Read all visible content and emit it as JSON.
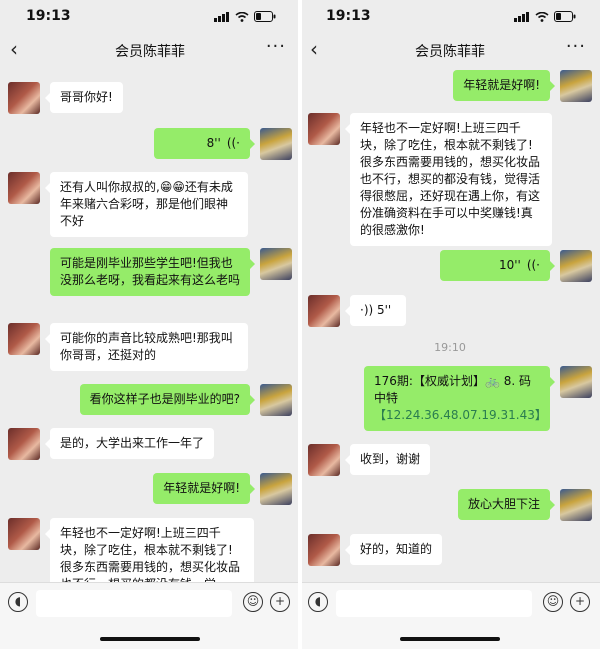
{
  "status": {
    "time": "19:13"
  },
  "chat": {
    "title": "会员陈菲菲",
    "back_icon": "‹",
    "more_icon": "···"
  },
  "left_messages": [
    {
      "text": "哥哥你好!"
    },
    {
      "duration": "8''"
    },
    {
      "text": "还有人叫你叔叔的,😁😁还有未成年来赌六合彩呀，那是他们眼神不好"
    },
    {
      "text": "可能是刚毕业那些学生吧!但我也没那么老呀，我看起来有这么老吗"
    },
    {
      "text": "可能你的声音比较成熟吧!那我叫你哥哥，还挺对的"
    },
    {
      "text": "看你这样子也是刚毕业的吧?"
    },
    {
      "text": "是的，大学出来工作一年了"
    },
    {
      "text": "年轻就是好啊!"
    },
    {
      "text": "年轻也不一定好啊!上班三四千块，除了吃住，根本就不剩钱了!很多东西需要用钱的，想买化妆品也不行，想买的都没有钱，觉"
    }
  ],
  "right_messages": [
    {
      "text": "年轻就是好啊!"
    },
    {
      "text": "年轻也不一定好啊!上班三四千块，除了吃住，根本就不剩钱了!很多东西需要用钱的，想买化妆品也不行，想买的都没有钱，觉得活得很憋屈，还好现在遇上你，有这份准确资料在手可以中奖赚钱!真的很感激你!"
    },
    {
      "duration": "10''"
    },
    {
      "duration": "5''"
    },
    {
      "timestamp": "19:10"
    },
    {
      "text_main": "176期:【权威计划】🚲 8. 码中特",
      "text_link": "【12.24.36.48.07.19.31.43】"
    },
    {
      "text": "收到，谢谢"
    },
    {
      "text": "放心大胆下注"
    },
    {
      "text": "好的，知道的"
    }
  ],
  "input_bar": {
    "voice_icon": "voice-icon",
    "emoji_icon": "emoji-icon",
    "plus_icon": "plus-icon"
  },
  "colors": {
    "bg": "#ededed",
    "out_bubble": "#95ec69",
    "in_bubble": "#ffffff"
  }
}
